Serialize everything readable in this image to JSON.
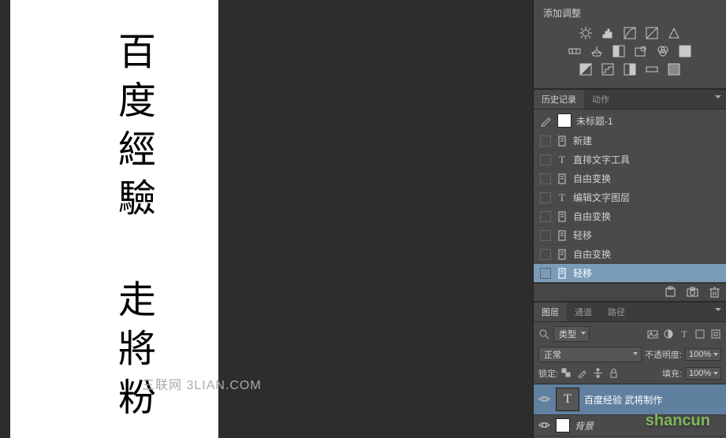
{
  "canvas": {
    "vertical_text": "百度經驗 走將粉",
    "watermark": "三联网 3LIAN.COM",
    "watermark2": "shancun"
  },
  "adjustments": {
    "title": "添加调整"
  },
  "history": {
    "tabs": {
      "history": "历史记录",
      "actions": "动作"
    },
    "doc_title": "未标题-1",
    "items": [
      {
        "icon": "doc",
        "label": "新建"
      },
      {
        "icon": "T",
        "label": "直排文字工具"
      },
      {
        "icon": "doc",
        "label": "自由变换"
      },
      {
        "icon": "T",
        "label": "编辑文字图层"
      },
      {
        "icon": "doc",
        "label": "自由变换"
      },
      {
        "icon": "doc",
        "label": "轻移"
      },
      {
        "icon": "doc",
        "label": "自由变换"
      },
      {
        "icon": "doc",
        "label": "轻移"
      }
    ]
  },
  "layers": {
    "tabs": {
      "layers": "图层",
      "channels": "通道",
      "paths": "路径"
    },
    "kind_label": "类型",
    "blend_mode": "正常",
    "opacity_label": "不透明度:",
    "opacity_value": "100%",
    "lock_label": "锁定:",
    "fill_label": "填充:",
    "fill_value": "100%",
    "items": [
      {
        "name": "百度经验 武将制作",
        "type": "text",
        "selected": true
      },
      {
        "name": "背景",
        "type": "bg",
        "selected": false
      }
    ]
  }
}
